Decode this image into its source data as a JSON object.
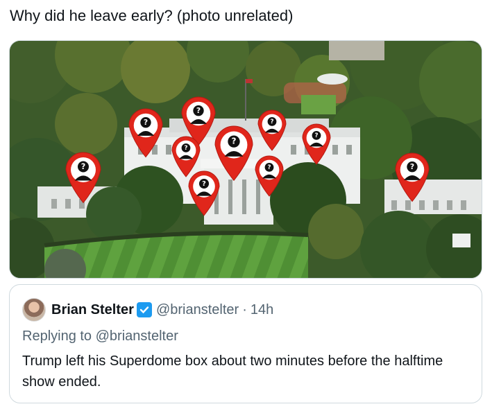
{
  "tweet": {
    "text": "Why did he leave early? (photo unrelated)"
  },
  "media": {
    "pin_glyph": "?",
    "pin_color": "#e0261b",
    "pin_count": 11
  },
  "quoted_tweet": {
    "author_name": "Brian Stelter",
    "verified_icon": "verified-badge-icon",
    "handle": "@brianstelter",
    "separator": "·",
    "time": "14h",
    "reply_line": "Replying to @brianstelter",
    "body": "Trump left his Superdome box about two minutes before the halftime show ended."
  },
  "colors": {
    "verified_blue": "#1d9bf0",
    "secondary_text": "#536471",
    "border": "#cfd9de"
  }
}
